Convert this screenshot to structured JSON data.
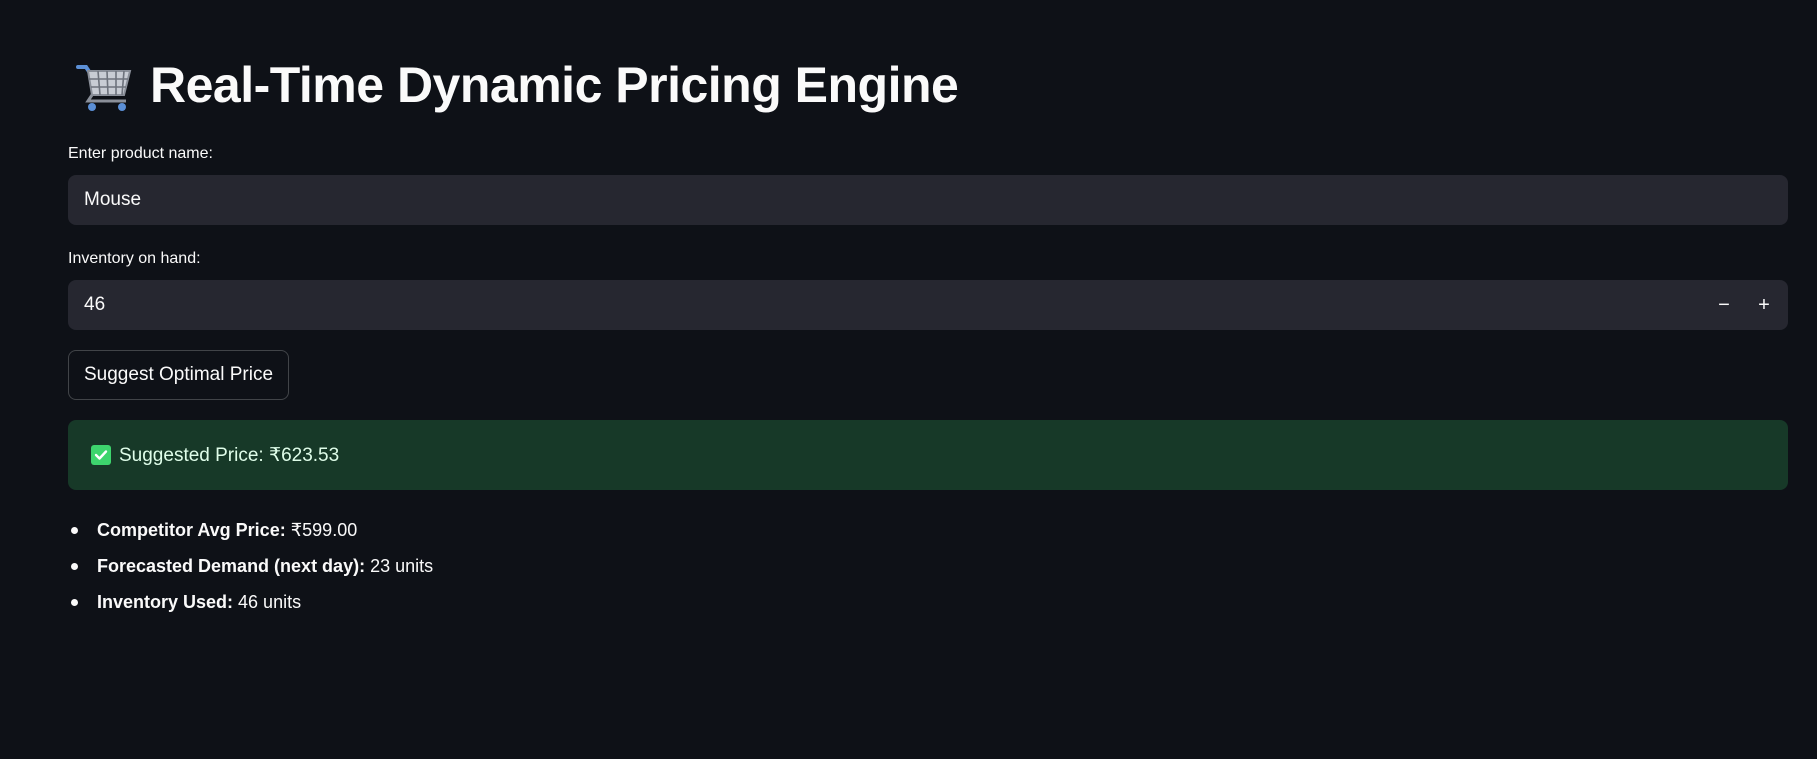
{
  "title": "Real-Time Dynamic Pricing Engine",
  "title_icon": "shopping-cart-icon",
  "product_field": {
    "label": "Enter product name:",
    "value": "Mouse"
  },
  "inventory_field": {
    "label": "Inventory on hand:",
    "value": "46",
    "decrement_label": "−",
    "increment_label": "+"
  },
  "suggest_button_label": "Suggest Optimal Price",
  "result": {
    "icon": "check-mark-icon",
    "text": "Suggested Price: ₹623.53",
    "color": "#173928"
  },
  "details": [
    {
      "label": "Competitor Avg Price:",
      "value": "₹599.00"
    },
    {
      "label": "Forecasted Demand (next day):",
      "value": "23 units"
    },
    {
      "label": "Inventory Used:",
      "value": "46 units"
    }
  ],
  "colors": {
    "background": "#0e1117",
    "input_background": "#262730",
    "success_check": "#3dd56d"
  }
}
